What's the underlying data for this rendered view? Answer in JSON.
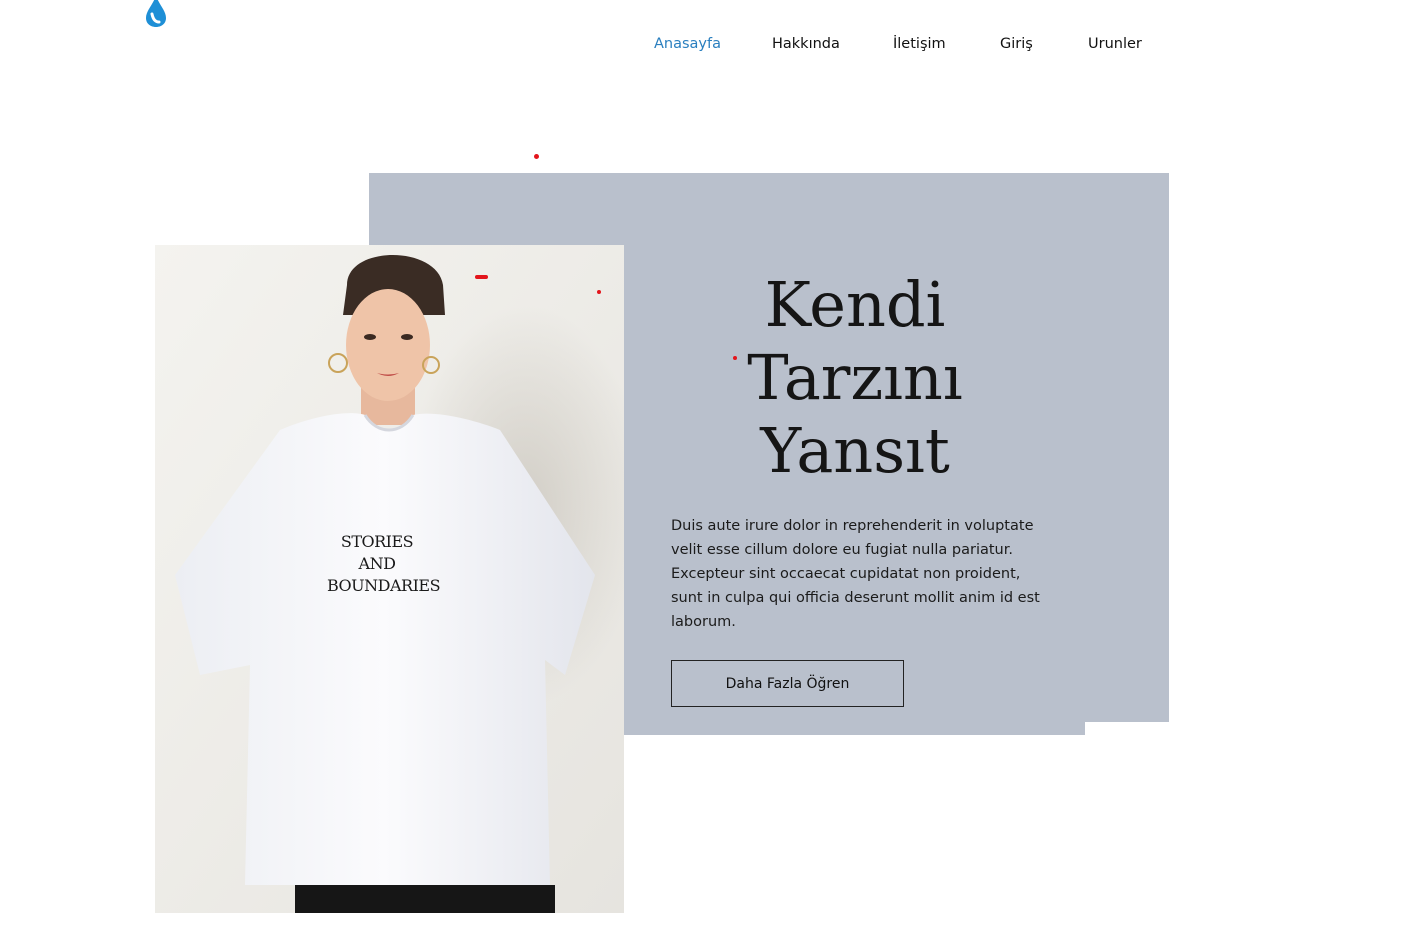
{
  "brand": {
    "logo_icon": "water-drop-logo-icon",
    "color": "#1e8fd6"
  },
  "nav": {
    "items": [
      {
        "label": "Anasayfa",
        "active": true
      },
      {
        "label": "Hakkında",
        "active": false
      },
      {
        "label": "İletişim",
        "active": false
      },
      {
        "label": "Giriş",
        "active": false
      },
      {
        "label": "Urunler",
        "active": false
      }
    ],
    "active_color": "#2a7fbf"
  },
  "hero": {
    "headline_lines": [
      "Kendi",
      "Tarzını",
      "Yansıt"
    ],
    "description": "Duis aute irure dolor in reprehenderit in voluptate velit esse cillum dolore eu fugiat nulla pariatur. Excepteur sint occaecat cupidatat non proident, sunt in culpa qui officia deserunt mollit anim id est laborum.",
    "cta_label": "Daha Fazla Öğren",
    "panel_color": "#b9c0cc",
    "image": {
      "description_icon": "model-tshirt-photo",
      "tshirt_print_lines": [
        "STORIES AND",
        "BOUNDARIES"
      ]
    }
  },
  "accent_dot_color": "#e3151c"
}
